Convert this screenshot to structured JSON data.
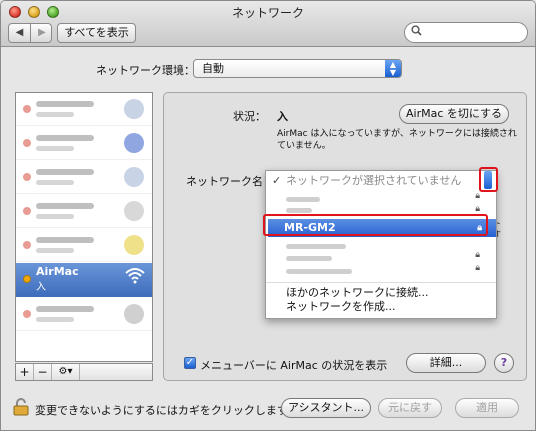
{
  "window": {
    "title": "ネットワーク"
  },
  "toolbar": {
    "back": "◀",
    "forward": "▶",
    "show_all": "すべてを表示",
    "search_placeholder": ""
  },
  "location": {
    "label": "ネットワーク環境：",
    "value": "自動"
  },
  "sidebar": {
    "selected": {
      "name": "AirMac",
      "status": "入"
    },
    "add": "+",
    "remove": "−",
    "action": "⚙︎▾"
  },
  "pane": {
    "status_label": "状況：",
    "status_value": "入",
    "turn_off_button": "AirMac を切にする",
    "status_desc_1": "AirMac は入になっていますが、ネットワークには接続され",
    "status_desc_2": "ていません。",
    "network_name_label": "ネットワーク名：",
    "menubar_checkbox": "メニューバーに AirMac の状況を表示",
    "advanced_button": "詳細...",
    "help": "?",
    "side_frag_1": "ット",
    "side_frag_2": "続す"
  },
  "dropdown": {
    "none_selected": "ネットワークが選択されていません",
    "check": "✓",
    "selected_network": "MR-GM2",
    "join_other": "ほかのネットワークに接続...",
    "create": "ネットワークを作成..."
  },
  "bottom": {
    "lock_text": "変更できないようにするにはカギをクリックします。",
    "assistant": "アシスタント...",
    "revert": "元に戻す",
    "apply": "適用"
  },
  "colors": {
    "accent": "#2760d2",
    "highlight_box": "#e0121b",
    "selected_row": "#3d6cbb"
  }
}
